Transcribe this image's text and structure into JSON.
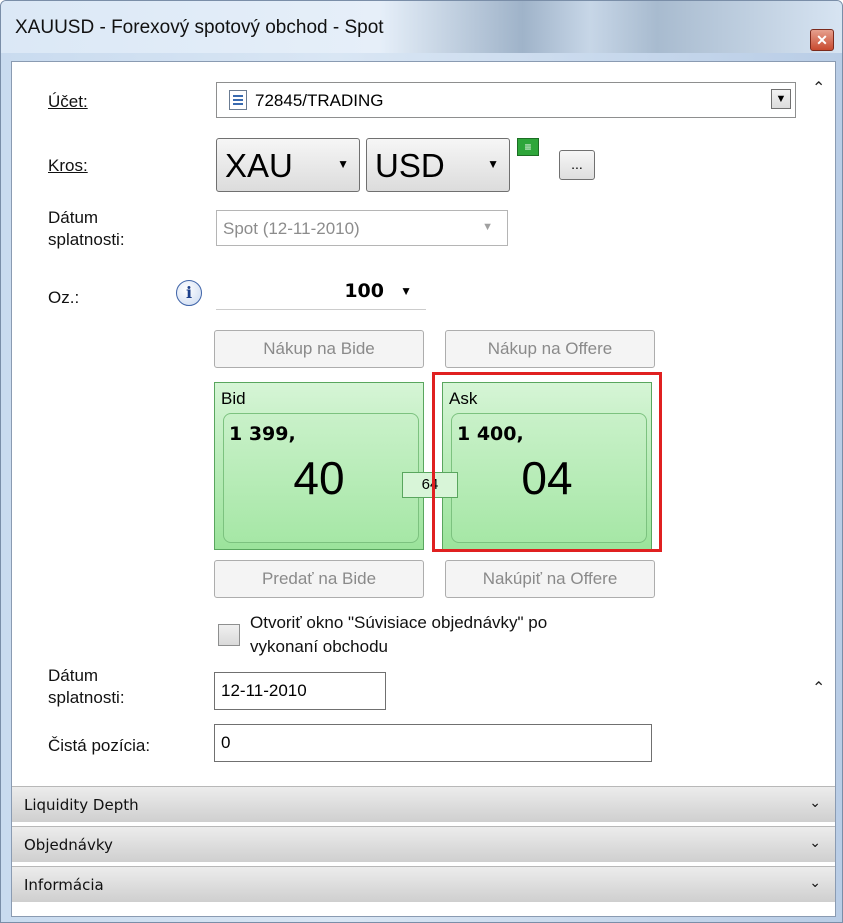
{
  "window": {
    "title": "XAUUSD - Forexový spotový obchod - Spot",
    "close_glyph": "✕"
  },
  "account": {
    "label": "Účet:",
    "value": "72845/TRADING"
  },
  "cross": {
    "label": "Kros:",
    "base": "XAU",
    "quote": "USD",
    "more_button": "..."
  },
  "value_date": {
    "label_line1": "Dátum",
    "label_line2": "splatnosti:",
    "value": "Spot (12-11-2010)"
  },
  "amount": {
    "label": "Oz.:",
    "value": "100"
  },
  "buttons": {
    "buy_bid": "Nákup na Bide",
    "buy_offer": "Nákup na Offere",
    "sell_bid": "Predať na Bide",
    "buy_offer2": "Nakúpiť na Offere"
  },
  "quote": {
    "bid": {
      "label": "Bid",
      "big_figure": "1 399,",
      "pips": "40"
    },
    "ask": {
      "label": "Ask",
      "big_figure": "1 400,",
      "pips": "04"
    },
    "spread": "64"
  },
  "related_orders": {
    "line1": "Otvoriť okno \"Súvisiace objednávky\" po",
    "line2": "vykonaní obchodu",
    "checked": false
  },
  "details": {
    "date_label_line1": "Dátum",
    "date_label_line2": "splatnosti:",
    "date_value": "12-11-2010",
    "net_position_label": "Čistá pozícia:",
    "net_position_value": "0"
  },
  "sections": [
    {
      "label": "Liquidity Depth"
    },
    {
      "label": "Objednávky"
    },
    {
      "label": "Informácia"
    }
  ],
  "colors": {
    "quote_tile": "#9be39b",
    "highlight": "#e02020"
  }
}
